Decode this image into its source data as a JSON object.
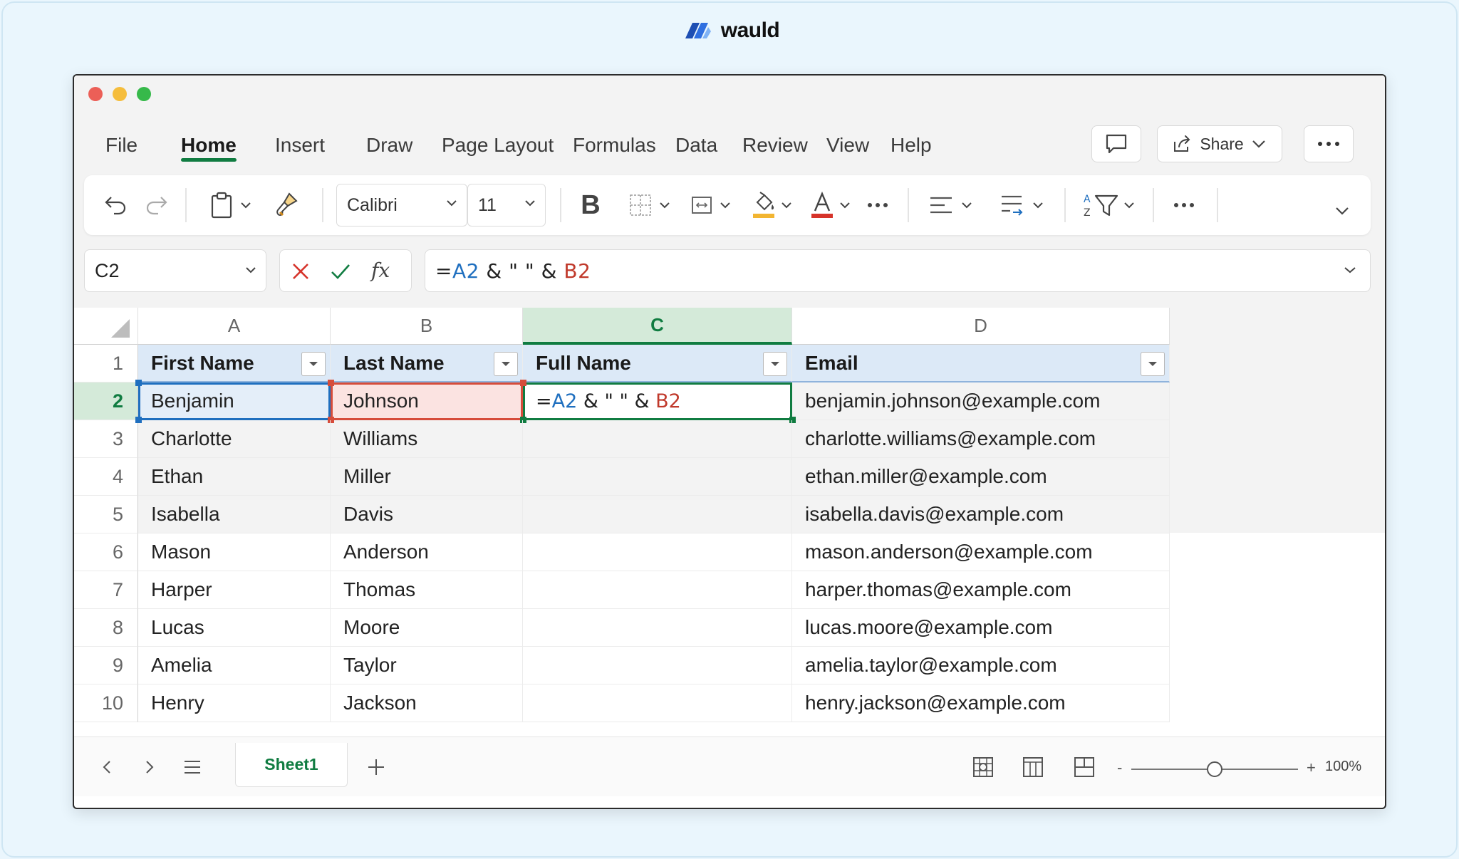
{
  "brand": {
    "name": "wauld"
  },
  "menu": {
    "tabs": [
      "File",
      "Home",
      "Insert",
      "Draw",
      "Page Layout",
      "Formulas",
      "Data",
      "Review",
      "View",
      "Help"
    ],
    "active": "Home",
    "share_label": "Share"
  },
  "toolbar": {
    "font_name": "Calibri",
    "font_size": "11",
    "bold_label": "B"
  },
  "formula_bar": {
    "name_box": "C2",
    "fx_label": "fx",
    "formula_parts": {
      "eq": "=",
      "ref_a": "A2",
      "mid": " & \" \" & ",
      "ref_b": "B2"
    }
  },
  "sheet": {
    "columns": [
      "A",
      "B",
      "C",
      "D"
    ],
    "selected_column": "C",
    "row_numbers": [
      "1",
      "2",
      "3",
      "4",
      "5",
      "6",
      "7",
      "8",
      "9",
      "10"
    ],
    "headers": [
      "First Name",
      "Last Name",
      "Full Name",
      "Email"
    ],
    "rows": [
      [
        "Benjamin",
        "Johnson",
        "",
        "benjamin.johnson@example.com"
      ],
      [
        "Charlotte",
        "Williams",
        "",
        "charlotte.williams@example.com"
      ],
      [
        "Ethan",
        "Miller",
        "",
        "ethan.miller@example.com"
      ],
      [
        "Isabella",
        "Davis",
        "",
        "isabella.davis@example.com"
      ],
      [
        "Mason",
        "Anderson",
        "",
        "mason.anderson@example.com"
      ],
      [
        "Harper",
        "Thomas",
        "",
        "harper.thomas@example.com"
      ],
      [
        "Lucas",
        "Moore",
        "",
        "lucas.moore@example.com"
      ],
      [
        "Amelia",
        "Taylor",
        "",
        "amelia.taylor@example.com"
      ],
      [
        "Henry",
        "Jackson",
        "",
        "henry.jackson@example.com"
      ]
    ]
  },
  "status": {
    "sheet_tab": "Sheet1",
    "zoom_minus": "-",
    "zoom_plus": "+",
    "zoom_label": "100%",
    "zoom_fraction": 0.5
  },
  "colors": {
    "accent_green": "#107c41",
    "ref_blue": "#1f6fbf",
    "ref_red": "#c0392b"
  },
  "icons": [
    "undo-icon",
    "redo-icon",
    "clipboard-icon",
    "format-painter-icon",
    "borders-icon",
    "merge-icon",
    "fill-color-icon",
    "font-color-icon",
    "align-icon",
    "wrap-icon",
    "sort-filter-icon",
    "comment-icon",
    "share-icon",
    "cancel-icon",
    "enter-icon",
    "fx-icon"
  ]
}
